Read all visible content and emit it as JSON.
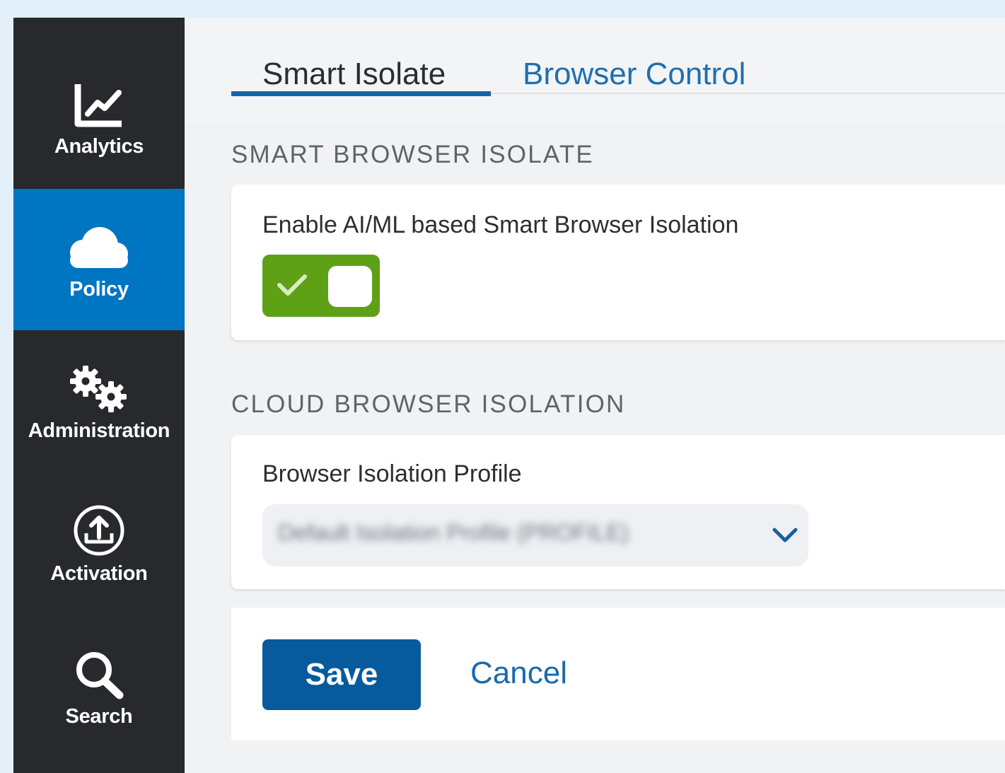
{
  "sidebar": {
    "items": [
      {
        "label": "Analytics",
        "icon": "line-chart-icon",
        "active": false
      },
      {
        "label": "Policy",
        "icon": "cloud-icon",
        "active": true
      },
      {
        "label": "Administration",
        "icon": "gears-icon",
        "active": false
      },
      {
        "label": "Activation",
        "icon": "upload-circle-icon",
        "active": false
      },
      {
        "label": "Search",
        "icon": "search-icon",
        "active": false
      }
    ]
  },
  "tabs": [
    {
      "label": "Smart Isolate",
      "active": true
    },
    {
      "label": "Browser Control",
      "active": false
    }
  ],
  "sections": {
    "smart": {
      "title": "SMART BROWSER ISOLATE",
      "toggle_label": "Enable AI/ML based Smart Browser Isolation",
      "toggle_enabled": true
    },
    "cloud": {
      "title": "CLOUD BROWSER ISOLATION",
      "profile_label": "Browser Isolation Profile",
      "profile_value": "Default Isolation Profile (PROFILE)"
    }
  },
  "actions": {
    "save_label": "Save",
    "cancel_label": "Cancel"
  },
  "colors": {
    "sidebar_bg": "#27292d",
    "active_nav": "#0075c2",
    "toggle_on": "#5ea117",
    "primary": "#075b9c",
    "link": "#1f6fb0"
  }
}
